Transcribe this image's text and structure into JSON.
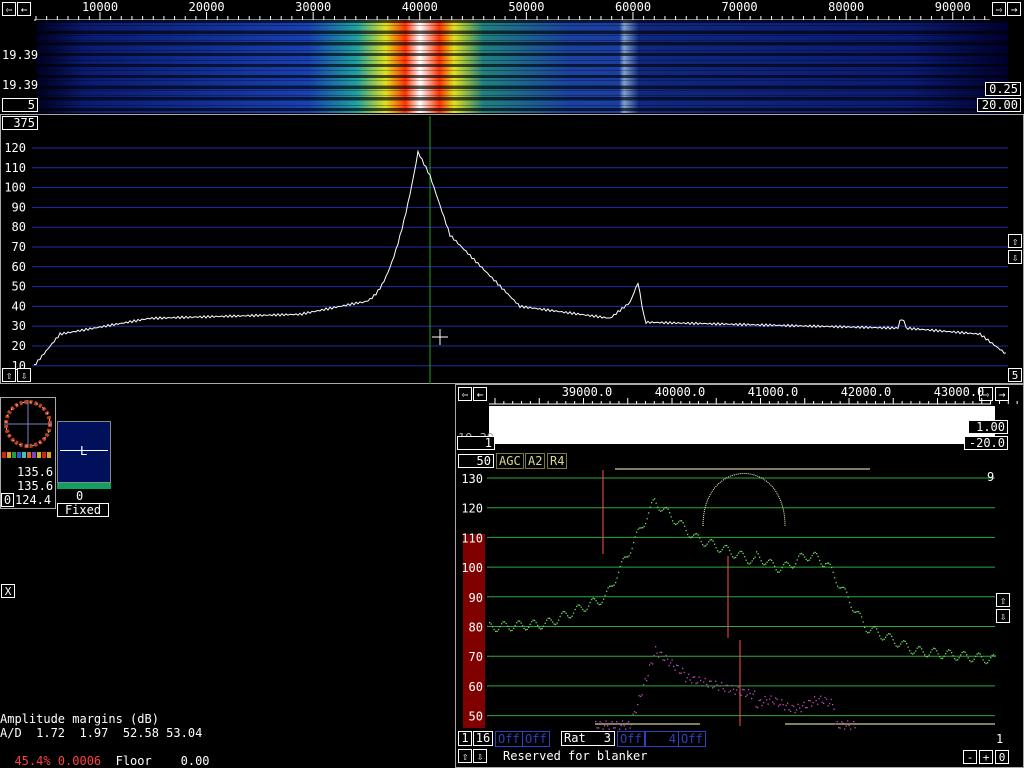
{
  "main_axis": {
    "ticks": [
      "10000",
      "20000",
      "30000",
      "40000",
      "50000",
      "60000",
      "70000",
      "80000",
      "90000"
    ]
  },
  "waterfall": {
    "left_label_1": "19.39",
    "left_label_2": "19.39",
    "avg_box": "5",
    "right_box_1": "0.25",
    "right_box_2": "20.00"
  },
  "spectrum": {
    "scale_box": "375",
    "y_ticks": [
      "120",
      "110",
      "100",
      "90",
      "80",
      "70",
      "60",
      "50",
      "40",
      "30",
      "20",
      "10"
    ],
    "right_corner": "5"
  },
  "smeter": {
    "value_1": "135.6",
    "value_2": "135.6",
    "value_3": "124.4",
    "corner_box": "0"
  },
  "agc_panel": {
    "letter": "L",
    "value": "0",
    "mode_label": "Fixed"
  },
  "close_button": "X",
  "status": {
    "line1": "Amplitude margins (dB)",
    "line2": "A/D  1.72  1.97  52.58 53.04",
    "line3_red": "45.4% 0.0006",
    "line3_rest": "  Floor    0.00"
  },
  "baseband": {
    "axis_ticks": [
      "39000.0",
      "40000.0",
      "41000.0",
      "42000.0",
      "43000.0"
    ],
    "cut_label": "19.39",
    "box_left": "1",
    "box_right_1": "1.00",
    "box_right_2": "-20.0",
    "box_50": "50",
    "tag_agc": "AGC",
    "tag_a2": "A2",
    "tag_r4": "R4",
    "y_ticks": [
      "130",
      "120",
      "110",
      "100",
      "90",
      "80",
      "70",
      "60",
      "50"
    ],
    "right_num": "9",
    "bottom": {
      "b1": "1",
      "b16": "16",
      "off1": "Off",
      "off2": "Off",
      "rat_label": "Rat",
      "rat_value": "3",
      "off3": "Off",
      "num4": "4",
      "off4": "Off",
      "right_one": "1",
      "blanker": "Reserved for blanker",
      "minus": "-",
      "plus": "+",
      "zero": "0"
    }
  },
  "colors": {
    "grid_blue": "#1c2fa8",
    "grid_green": "#2ea83a",
    "spectrum_white": "#ffffff",
    "green_trace": "#6fd86a",
    "magenta_trace": "#c050c0",
    "marker_red": "#ff5050",
    "status_red": "#ff4040",
    "bar_darkred": "#800000"
  }
}
